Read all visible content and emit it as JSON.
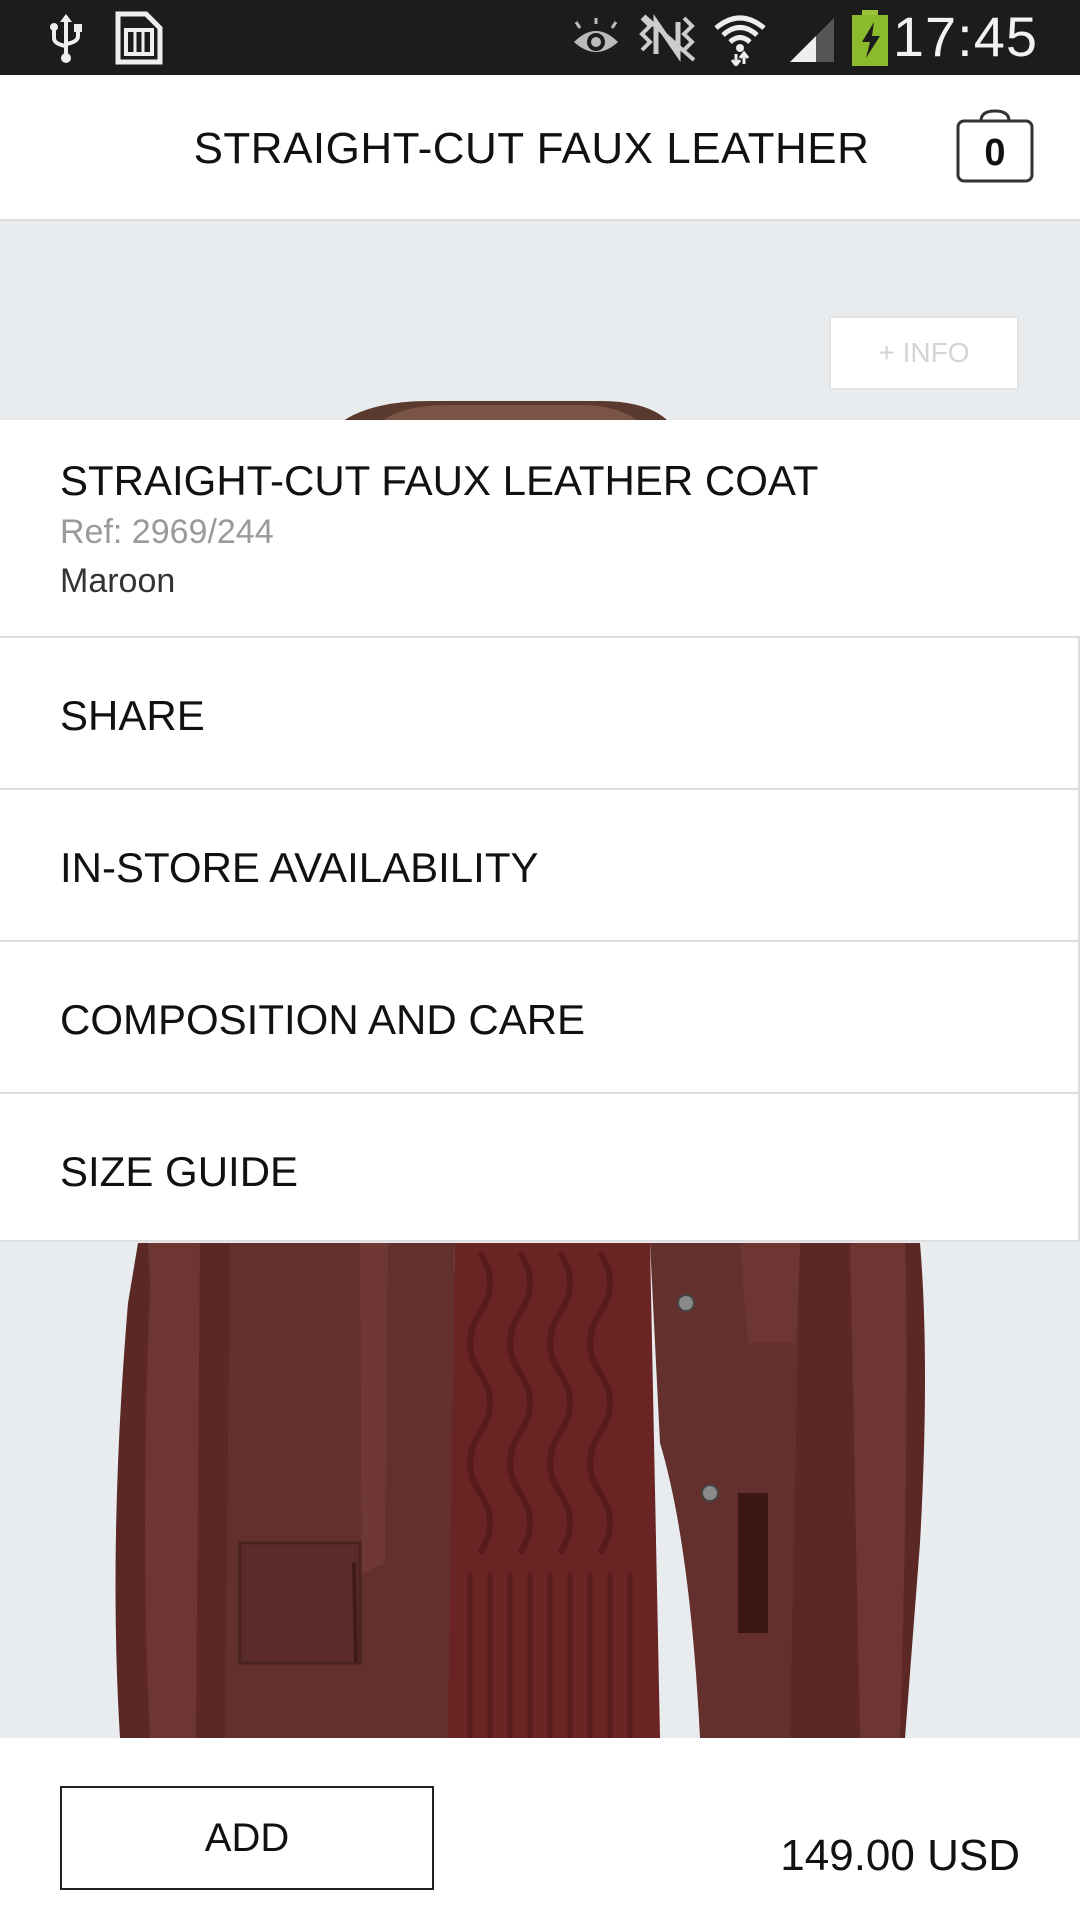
{
  "status_bar": {
    "time": "17:45",
    "icons": [
      "usb-icon",
      "sim-card-icon",
      "eye-icon",
      "no-network-icon",
      "wifi-icon",
      "signal-icon",
      "battery-charging-icon"
    ]
  },
  "header": {
    "title": "STRAIGHT-CUT FAUX LEATHER",
    "cart_count": "0",
    "cart_icon": "shopping-bag-icon"
  },
  "info_button": {
    "label": "+ INFO"
  },
  "product": {
    "name": "STRAIGHT-CUT FAUX LEATHER COAT",
    "ref": "Ref: 2969/244",
    "color": "Maroon"
  },
  "menu": [
    {
      "label": "SHARE"
    },
    {
      "label": "IN-STORE AVAILABILITY"
    },
    {
      "label": "COMPOSITION AND CARE"
    },
    {
      "label": "SIZE GUIDE"
    }
  ],
  "footer": {
    "add_label": "ADD",
    "price": "149.00 USD"
  },
  "colors": {
    "status_bar_bg": "#1c1c1c",
    "coat_maroon": "#5e2a28",
    "divider": "#dedede",
    "photo_bg": "#e9ecee"
  }
}
